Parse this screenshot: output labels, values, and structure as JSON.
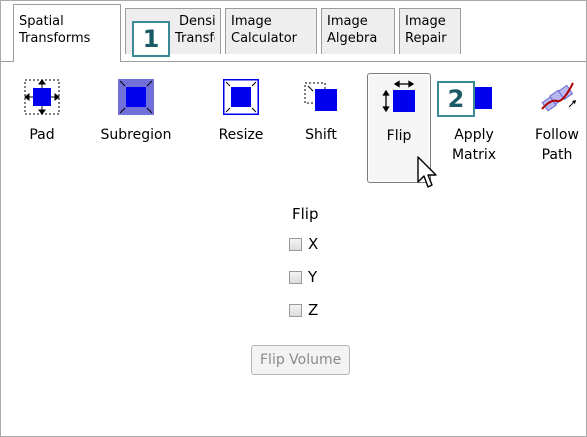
{
  "tabs": [
    {
      "line1": "Spatial",
      "line2": "Transforms"
    },
    {
      "line1": "Density",
      "line2": "Transforms"
    },
    {
      "line1": "Image",
      "line2": "Calculator"
    },
    {
      "line1": "Image",
      "line2": "Algebra"
    },
    {
      "line1": "Image",
      "line2": "Repair"
    }
  ],
  "markers": [
    "1",
    "2"
  ],
  "tools": [
    {
      "label": "Pad",
      "icon": "pad-icon"
    },
    {
      "label": "Subregion",
      "icon": "subregion-icon"
    },
    {
      "label": "Resize",
      "icon": "resize-icon"
    },
    {
      "label": "Shift",
      "icon": "shift-icon"
    },
    {
      "label": "Flip",
      "icon": "flip-icon"
    },
    {
      "label1": "Apply",
      "label2": "Matrix",
      "icon": "apply-matrix-icon"
    },
    {
      "label1": "Follow",
      "label2": "Path",
      "icon": "follow-path-icon"
    }
  ],
  "panel": {
    "title": "Flip",
    "options": [
      "X",
      "Y",
      "Z"
    ],
    "button": "Flip Volume"
  },
  "colors": {
    "accent": "#0000ee",
    "marker": "#3a8a95"
  }
}
